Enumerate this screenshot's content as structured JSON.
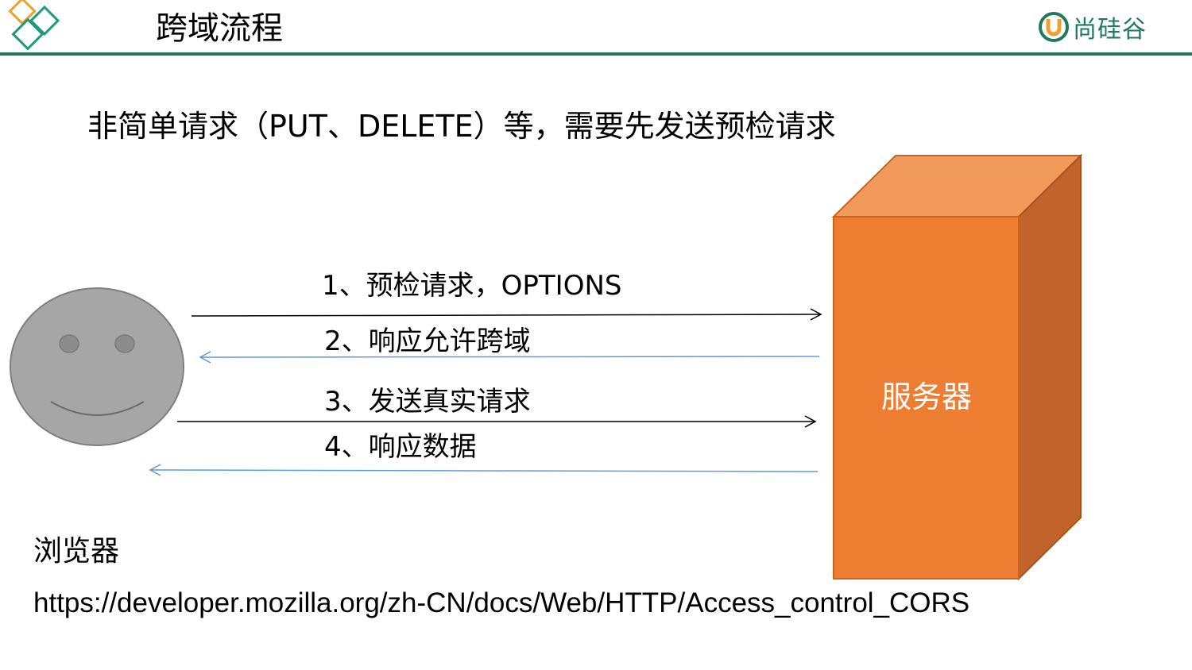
{
  "header": {
    "title": "跨域流程",
    "brand_name": "尚硅谷",
    "accent_color": "#1f7a5c"
  },
  "subtitle": "非简单请求（PUT、DELETE）等，需要先发送预检请求",
  "diagram": {
    "client_icon": "smiley-face-icon",
    "client_label": "浏览器",
    "server_label": "服务器",
    "server_color": "#ed7d31",
    "steps": [
      {
        "label": "1、预检请求，OPTIONS",
        "direction": "to-server",
        "color": "#000000"
      },
      {
        "label": "2、响应允许跨域",
        "direction": "to-client",
        "color": "#5b9bd5"
      },
      {
        "label": "3、发送真实请求",
        "direction": "to-server",
        "color": "#000000"
      },
      {
        "label": "4、响应数据",
        "direction": "to-client",
        "color": "#5b9bd5"
      }
    ]
  },
  "reference_link": "https://developer.mozilla.org/zh-CN/docs/Web/HTTP/Access_control_CORS"
}
